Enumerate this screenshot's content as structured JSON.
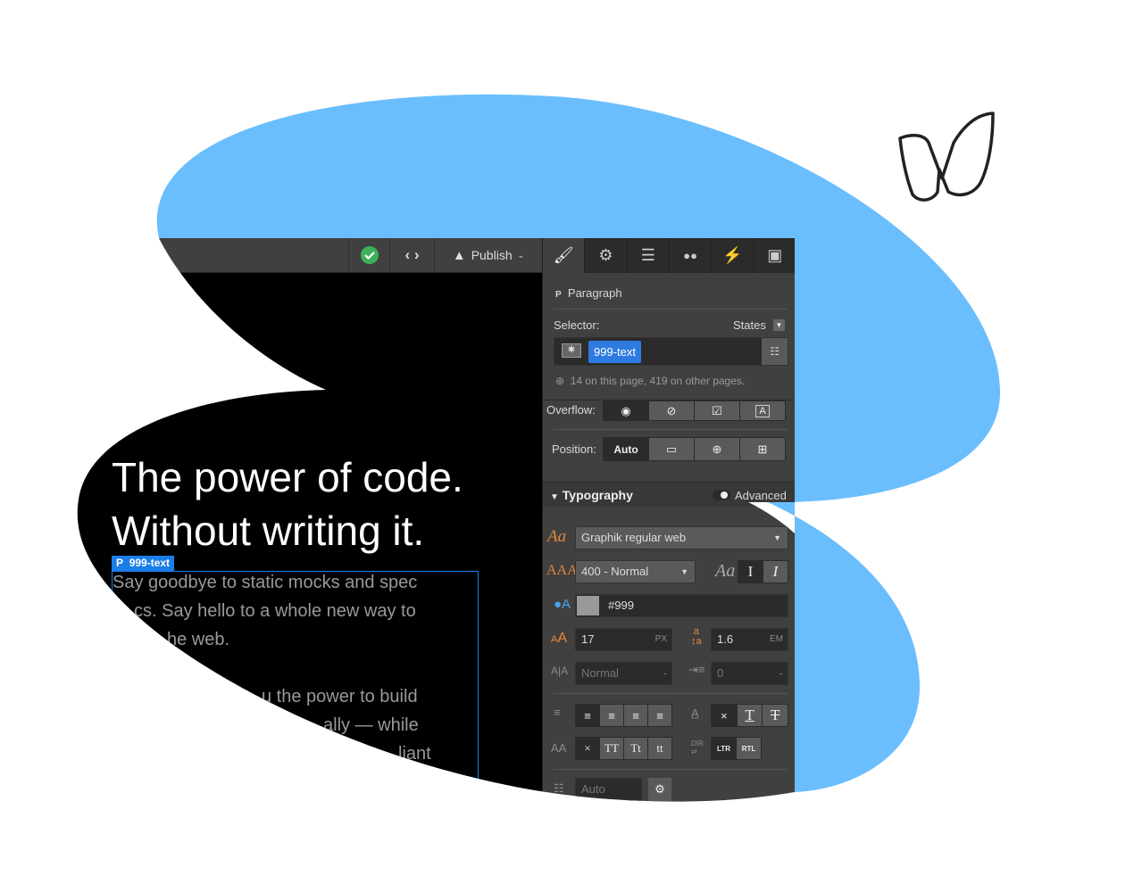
{
  "colors": {
    "blob": "#6bbefd",
    "accent": "#1a7ee8",
    "panel": "#404040",
    "canvas": "#000000"
  },
  "logo": {
    "name": "webflow-logo",
    "letter": "W"
  },
  "toolbar": {
    "status_icon": "check-circle-icon",
    "code_icon": "code-icon",
    "publish_label": "Publish"
  },
  "canvas": {
    "heading": [
      "The power of code.",
      "Without writing it."
    ],
    "selected_label": {
      "tag": "P",
      "class": "999-text"
    },
    "paragraph_lines": [
      "Say goodbye to static mocks and spec",
      "cs. Say hello to a whole new way to",
      "he web.",
      "u the power to build",
      "ally — while",
      "liant"
    ]
  },
  "panel": {
    "tabs": [
      "style-brush-icon",
      "settings-gear-icon",
      "navigator-icon",
      "interactions-drops-icon",
      "lightning-icon",
      "assets-icon"
    ],
    "element": {
      "tag": "P",
      "type": "Paragraph"
    },
    "selector_label": "Selector:",
    "states_label": "States",
    "selector_chip": "999-text",
    "usage": "14 on this page, 419 on other pages.",
    "overflow_label": "Overflow:",
    "position_label": "Position:",
    "position_value": "Auto",
    "typography": {
      "title": "Typography",
      "advanced_label": "Advanced",
      "font": "Graphik regular web",
      "weight": "400 - Normal",
      "style_label": "Aa",
      "color": "#999",
      "size": "17",
      "size_unit": "PX",
      "line_height": "1.6",
      "line_height_unit": "EM",
      "letter_spacing": "Normal",
      "letter_spacing_unit": "-",
      "indent": "0",
      "indent_unit": "-",
      "decoration_buttons": [
        "×",
        "T",
        "T"
      ],
      "case_label": "AA",
      "case_buttons": [
        "×",
        "TT",
        "Tt",
        "tt"
      ],
      "dir_label": "DIR",
      "dir_buttons": [
        "LTR",
        "RTL"
      ],
      "columns": "Auto"
    }
  }
}
